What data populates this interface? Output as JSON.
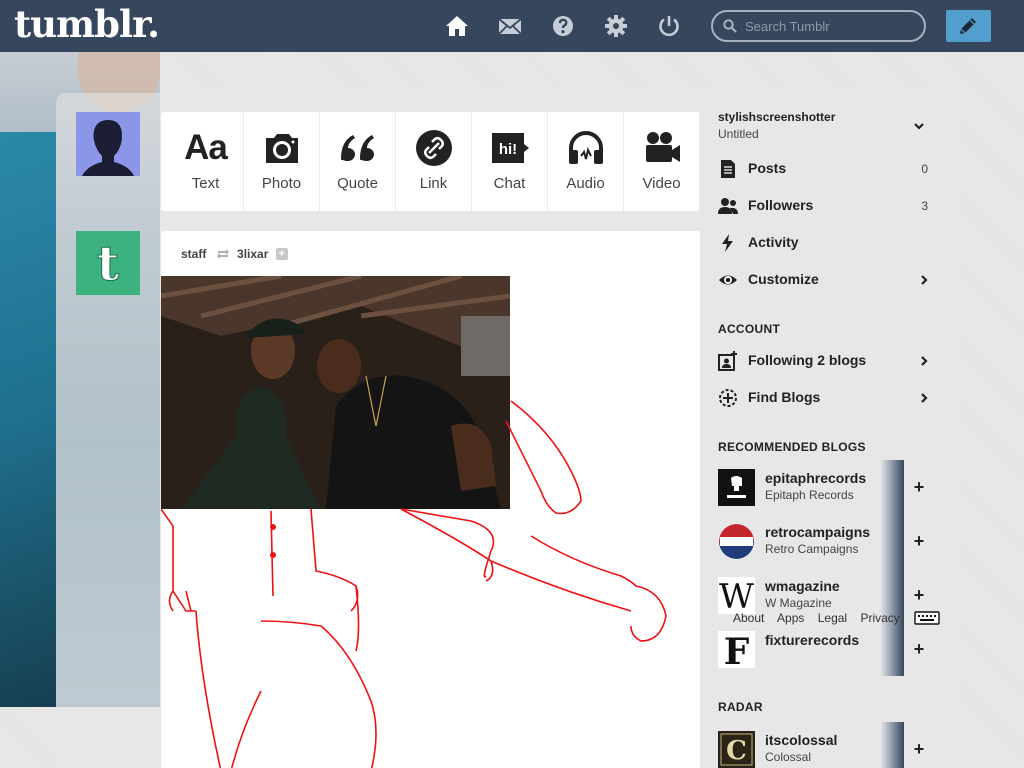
{
  "header": {
    "logo": "tumblr.",
    "nav": [
      "home-icon",
      "mail-icon",
      "help-icon",
      "settings-icon",
      "power-icon"
    ],
    "search_placeholder": "Search Tumblr",
    "compose_icon": "pencil-icon",
    "bar_color": "#36465d",
    "compose_color": "#529ecc"
  },
  "post_types": [
    {
      "label": "Text",
      "icon": "text-icon"
    },
    {
      "label": "Photo",
      "icon": "camera-icon"
    },
    {
      "label": "Quote",
      "icon": "quote-icon"
    },
    {
      "label": "Link",
      "icon": "link-icon"
    },
    {
      "label": "Chat",
      "icon": "chat-icon"
    },
    {
      "label": "Audio",
      "icon": "headphones-icon"
    },
    {
      "label": "Video",
      "icon": "video-camera-icon"
    }
  ],
  "text_glyph": "Aa",
  "chat_glyph": "hi!",
  "post": {
    "author": "staff",
    "reblogged_from": "3lixar",
    "follow_symbol": "+"
  },
  "sidebar": {
    "blog_name": "stylishscreenshotter",
    "blog_title": "Untitled",
    "items": [
      {
        "label": "Posts",
        "count": "0",
        "icon": "posts-icon"
      },
      {
        "label": "Followers",
        "count": "3",
        "icon": "followers-icon"
      },
      {
        "label": "Activity",
        "icon": "activity-icon"
      },
      {
        "label": "Customize",
        "icon": "eye-icon"
      }
    ],
    "account_heading": "ACCOUNT",
    "account_items": [
      {
        "label": "Following 2 blogs",
        "icon": "following-icon"
      },
      {
        "label": "Find Blogs",
        "icon": "find-blogs-icon"
      }
    ],
    "recommended_heading": "RECOMMENDED BLOGS",
    "recommended": [
      {
        "name": "epitaphrecords",
        "title": "Epitaph Records"
      },
      {
        "name": "retrocampaigns",
        "title": "Retro Campaigns"
      },
      {
        "name": "wmagazine",
        "title": "W Magazine"
      },
      {
        "name": "fixturerecords",
        "title": ""
      }
    ],
    "radar_heading": "RADAR",
    "radar": [
      {
        "name": "itscolossal",
        "title": "Colossal"
      }
    ],
    "add_symbol": "+",
    "footer_links": [
      "About",
      "Apps",
      "Legal",
      "Privacy"
    ]
  }
}
